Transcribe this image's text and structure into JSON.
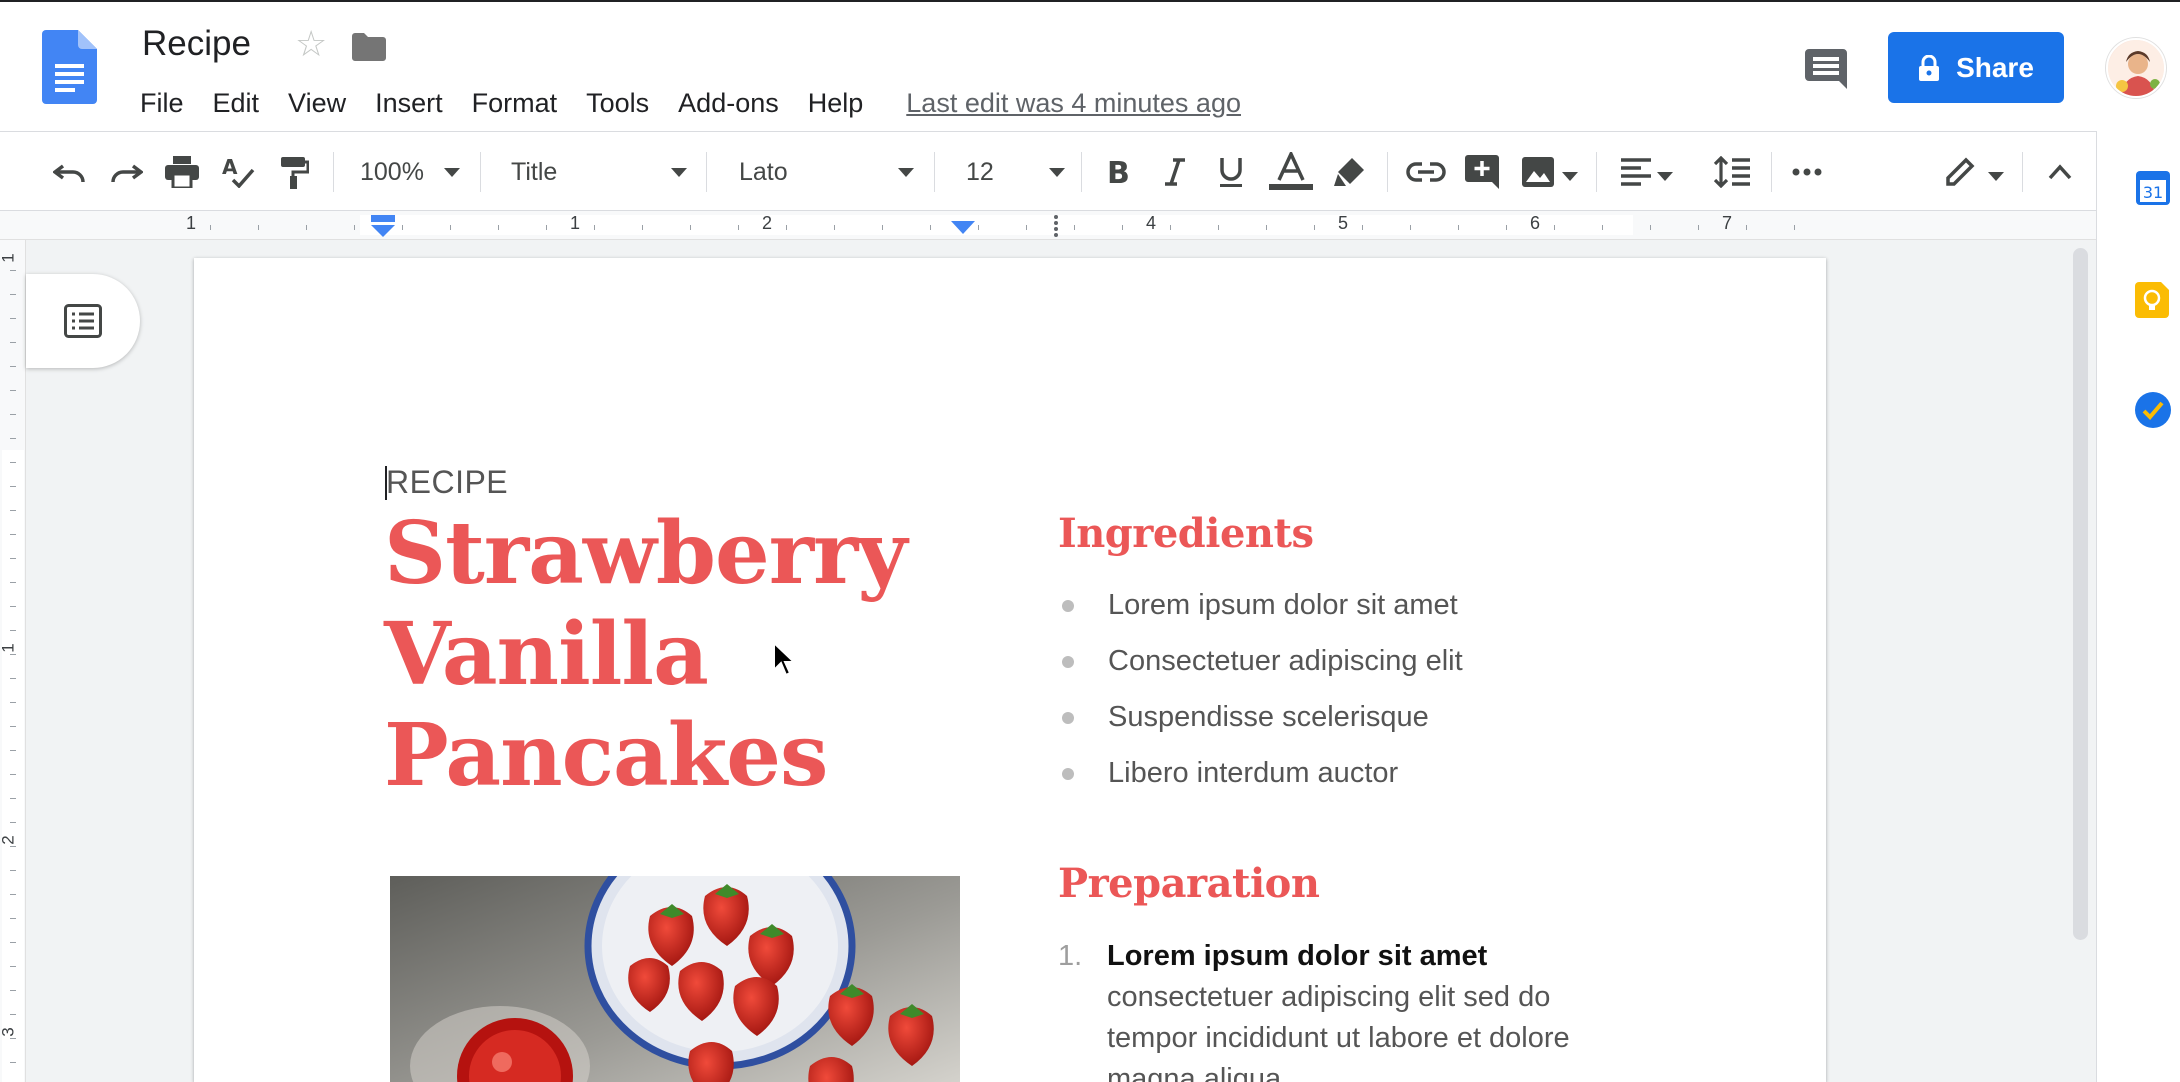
{
  "header": {
    "doc_title": "Recipe",
    "menu": [
      "File",
      "Edit",
      "View",
      "Insert",
      "Format",
      "Tools",
      "Add-ons",
      "Help"
    ],
    "last_edit": "Last edit was 4 minutes ago",
    "share_label": "Share"
  },
  "toolbar": {
    "zoom": "100%",
    "style": "Title",
    "font": "Lato",
    "font_size": "12",
    "icons": [
      "undo-icon",
      "redo-icon",
      "print-icon",
      "spellcheck-icon",
      "paint-format-icon",
      "bold-icon",
      "italic-icon",
      "underline-icon",
      "text-color-icon",
      "highlight-icon",
      "link-icon",
      "add-comment-icon",
      "insert-image-icon",
      "align-icon",
      "line-spacing-icon",
      "more-icon",
      "editing-mode-icon",
      "collapse-icon"
    ]
  },
  "ruler": {
    "labels": [
      "1",
      "1",
      "2",
      "4",
      "5",
      "6",
      "7"
    ]
  },
  "vertical_ruler": {
    "labels": [
      "1",
      "1",
      "2",
      "3"
    ]
  },
  "document": {
    "kicker": "RECIPE",
    "title_lines": [
      "Strawberry",
      "Vanilla",
      "Pancakes"
    ],
    "ingredients_heading": "Ingredients",
    "ingredients": [
      "Lorem ipsum dolor sit amet",
      "Consectetuer adipiscing elit",
      "Suspendisse scelerisque",
      "Libero interdum auctor"
    ],
    "preparation_heading": "Preparation",
    "preparation": [
      {
        "number": "1.",
        "bold": "Lorem ipsum dolor sit amet",
        "lines": [
          "consectetuer adipiscing elit sed do",
          "tempor incididunt ut labore et dolore",
          "magna aliqua."
        ]
      }
    ]
  },
  "colors": {
    "accent": "#eb5757",
    "share_blue": "#1a73e8",
    "docs_blue": "#4285f4"
  },
  "side_panel": {
    "icons": [
      "calendar-icon",
      "keep-icon",
      "tasks-icon"
    ],
    "calendar_day": "31"
  }
}
